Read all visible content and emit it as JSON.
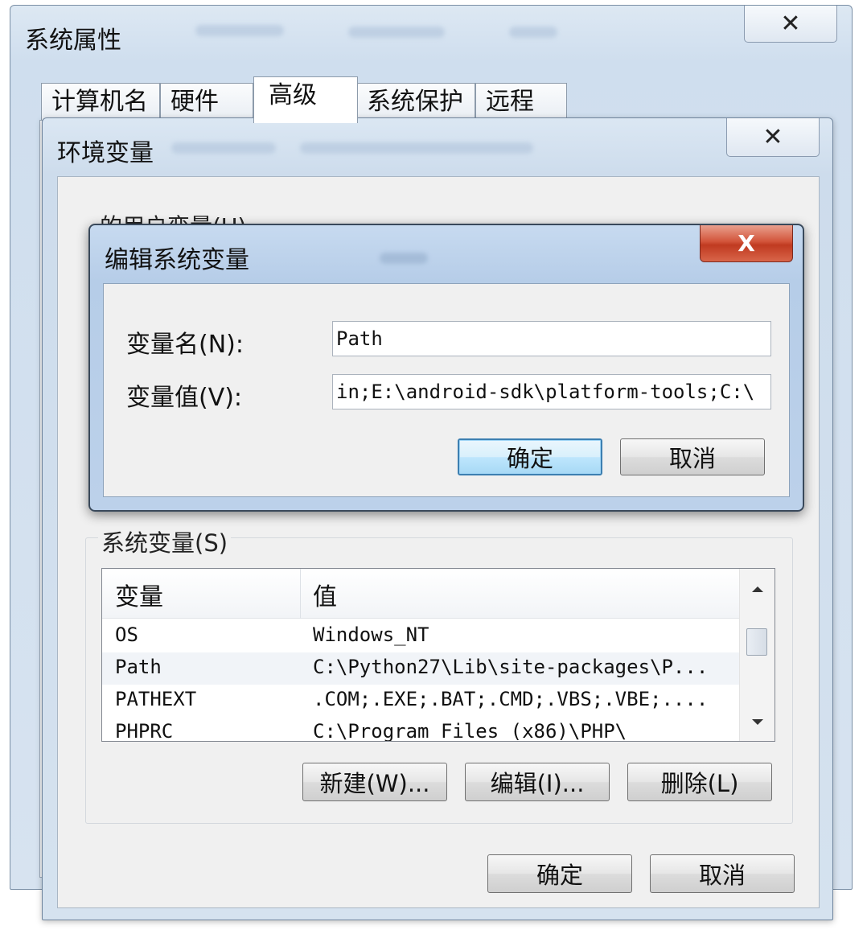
{
  "system_properties": {
    "title": "系统属性",
    "close_symbol": "✕",
    "tabs": [
      {
        "label": "计算机名"
      },
      {
        "label": "硬件"
      },
      {
        "label": "高级"
      },
      {
        "label": "系统保护"
      },
      {
        "label": "远程"
      }
    ],
    "active_tab": "高级"
  },
  "environment_variables": {
    "title": "环境变量",
    "close_symbol": "✕",
    "user_vars_label_partial": "的用户变量(U)",
    "system_vars_label": "系统变量(S)",
    "table": {
      "columns": [
        "变量",
        "值"
      ],
      "rows": [
        {
          "name": "OS",
          "value": "Windows_NT"
        },
        {
          "name": "Path",
          "value": "C:\\Python27\\Lib\\site-packages\\P..."
        },
        {
          "name": "PATHEXT",
          "value": ".COM;.EXE;.BAT;.CMD;.VBS;.VBE;...."
        },
        {
          "name": "PHPRC",
          "value": "C:\\Program Files (x86)\\PHP\\"
        }
      ],
      "selected_row": "Path"
    },
    "buttons": {
      "new": "新建(W)...",
      "edit": "编辑(I)...",
      "delete": "删除(L)",
      "ok": "确定",
      "cancel": "取消"
    }
  },
  "edit_system_variable": {
    "title": "编辑系统变量",
    "close_symbol": "X",
    "name_label": "变量名(N):",
    "name_value": "Path",
    "value_label": "变量值(V):",
    "value_value": "in;E:\\android-sdk\\platform-tools;C:\\",
    "buttons": {
      "ok": "确定",
      "cancel": "取消"
    }
  },
  "colors": {
    "close_red": "#c03a20",
    "default_button_border": "#3c7fb1",
    "title_bar_blue": "#cddcec"
  }
}
